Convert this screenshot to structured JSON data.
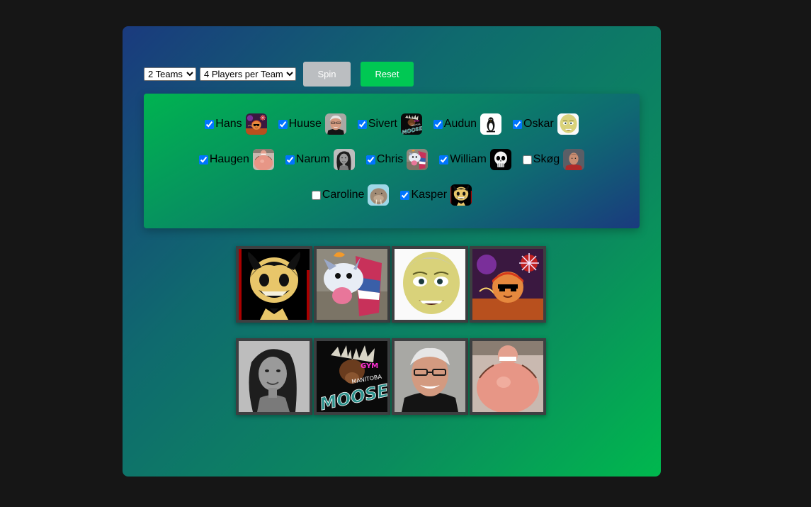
{
  "controls": {
    "teams_select": {
      "selected": "2 Teams",
      "options": [
        "2 Teams"
      ]
    },
    "players_select": {
      "selected": "4 Players per Team",
      "options": [
        "4 Players per Team"
      ]
    },
    "spin_label": "Spin",
    "reset_label": "Reset"
  },
  "players": [
    {
      "name": "Hans",
      "checked": true,
      "avatar": "firework-kid-avatar"
    },
    {
      "name": "Huuse",
      "checked": true,
      "avatar": "old-man-avatar"
    },
    {
      "name": "Sivert",
      "checked": true,
      "avatar": "moose-logo-avatar"
    },
    {
      "name": "Audun",
      "checked": true,
      "avatar": "penguin-avatar"
    },
    {
      "name": "Oskar",
      "checked": true,
      "avatar": "cartoon-face-avatar"
    },
    {
      "name": "Haugen",
      "checked": true,
      "avatar": "belly-avatar"
    },
    {
      "name": "Narum",
      "checked": true,
      "avatar": "woman-portrait-avatar"
    },
    {
      "name": "Chris",
      "checked": true,
      "avatar": "poro-avatar"
    },
    {
      "name": "William",
      "checked": true,
      "avatar": "skull-avatar"
    },
    {
      "name": "Skøg",
      "checked": false,
      "avatar": "man-avatar"
    },
    {
      "name": "Caroline",
      "checked": false,
      "avatar": "walrus-avatar"
    },
    {
      "name": "Kasper",
      "checked": true,
      "avatar": "bendy-avatar"
    }
  ],
  "teams": [
    {
      "members": [
        "bendy",
        "poro",
        "cartoon-face",
        "firework-kid"
      ]
    },
    {
      "members": [
        "woman-portrait",
        "moose-logo",
        "old-man",
        "belly"
      ]
    }
  ],
  "colors": {
    "page_bg": "#161616",
    "spin_button": "#bbbec1",
    "reset_button": "#00c853",
    "checkbox": "#0075ff",
    "card_border": "#3d3f41"
  }
}
